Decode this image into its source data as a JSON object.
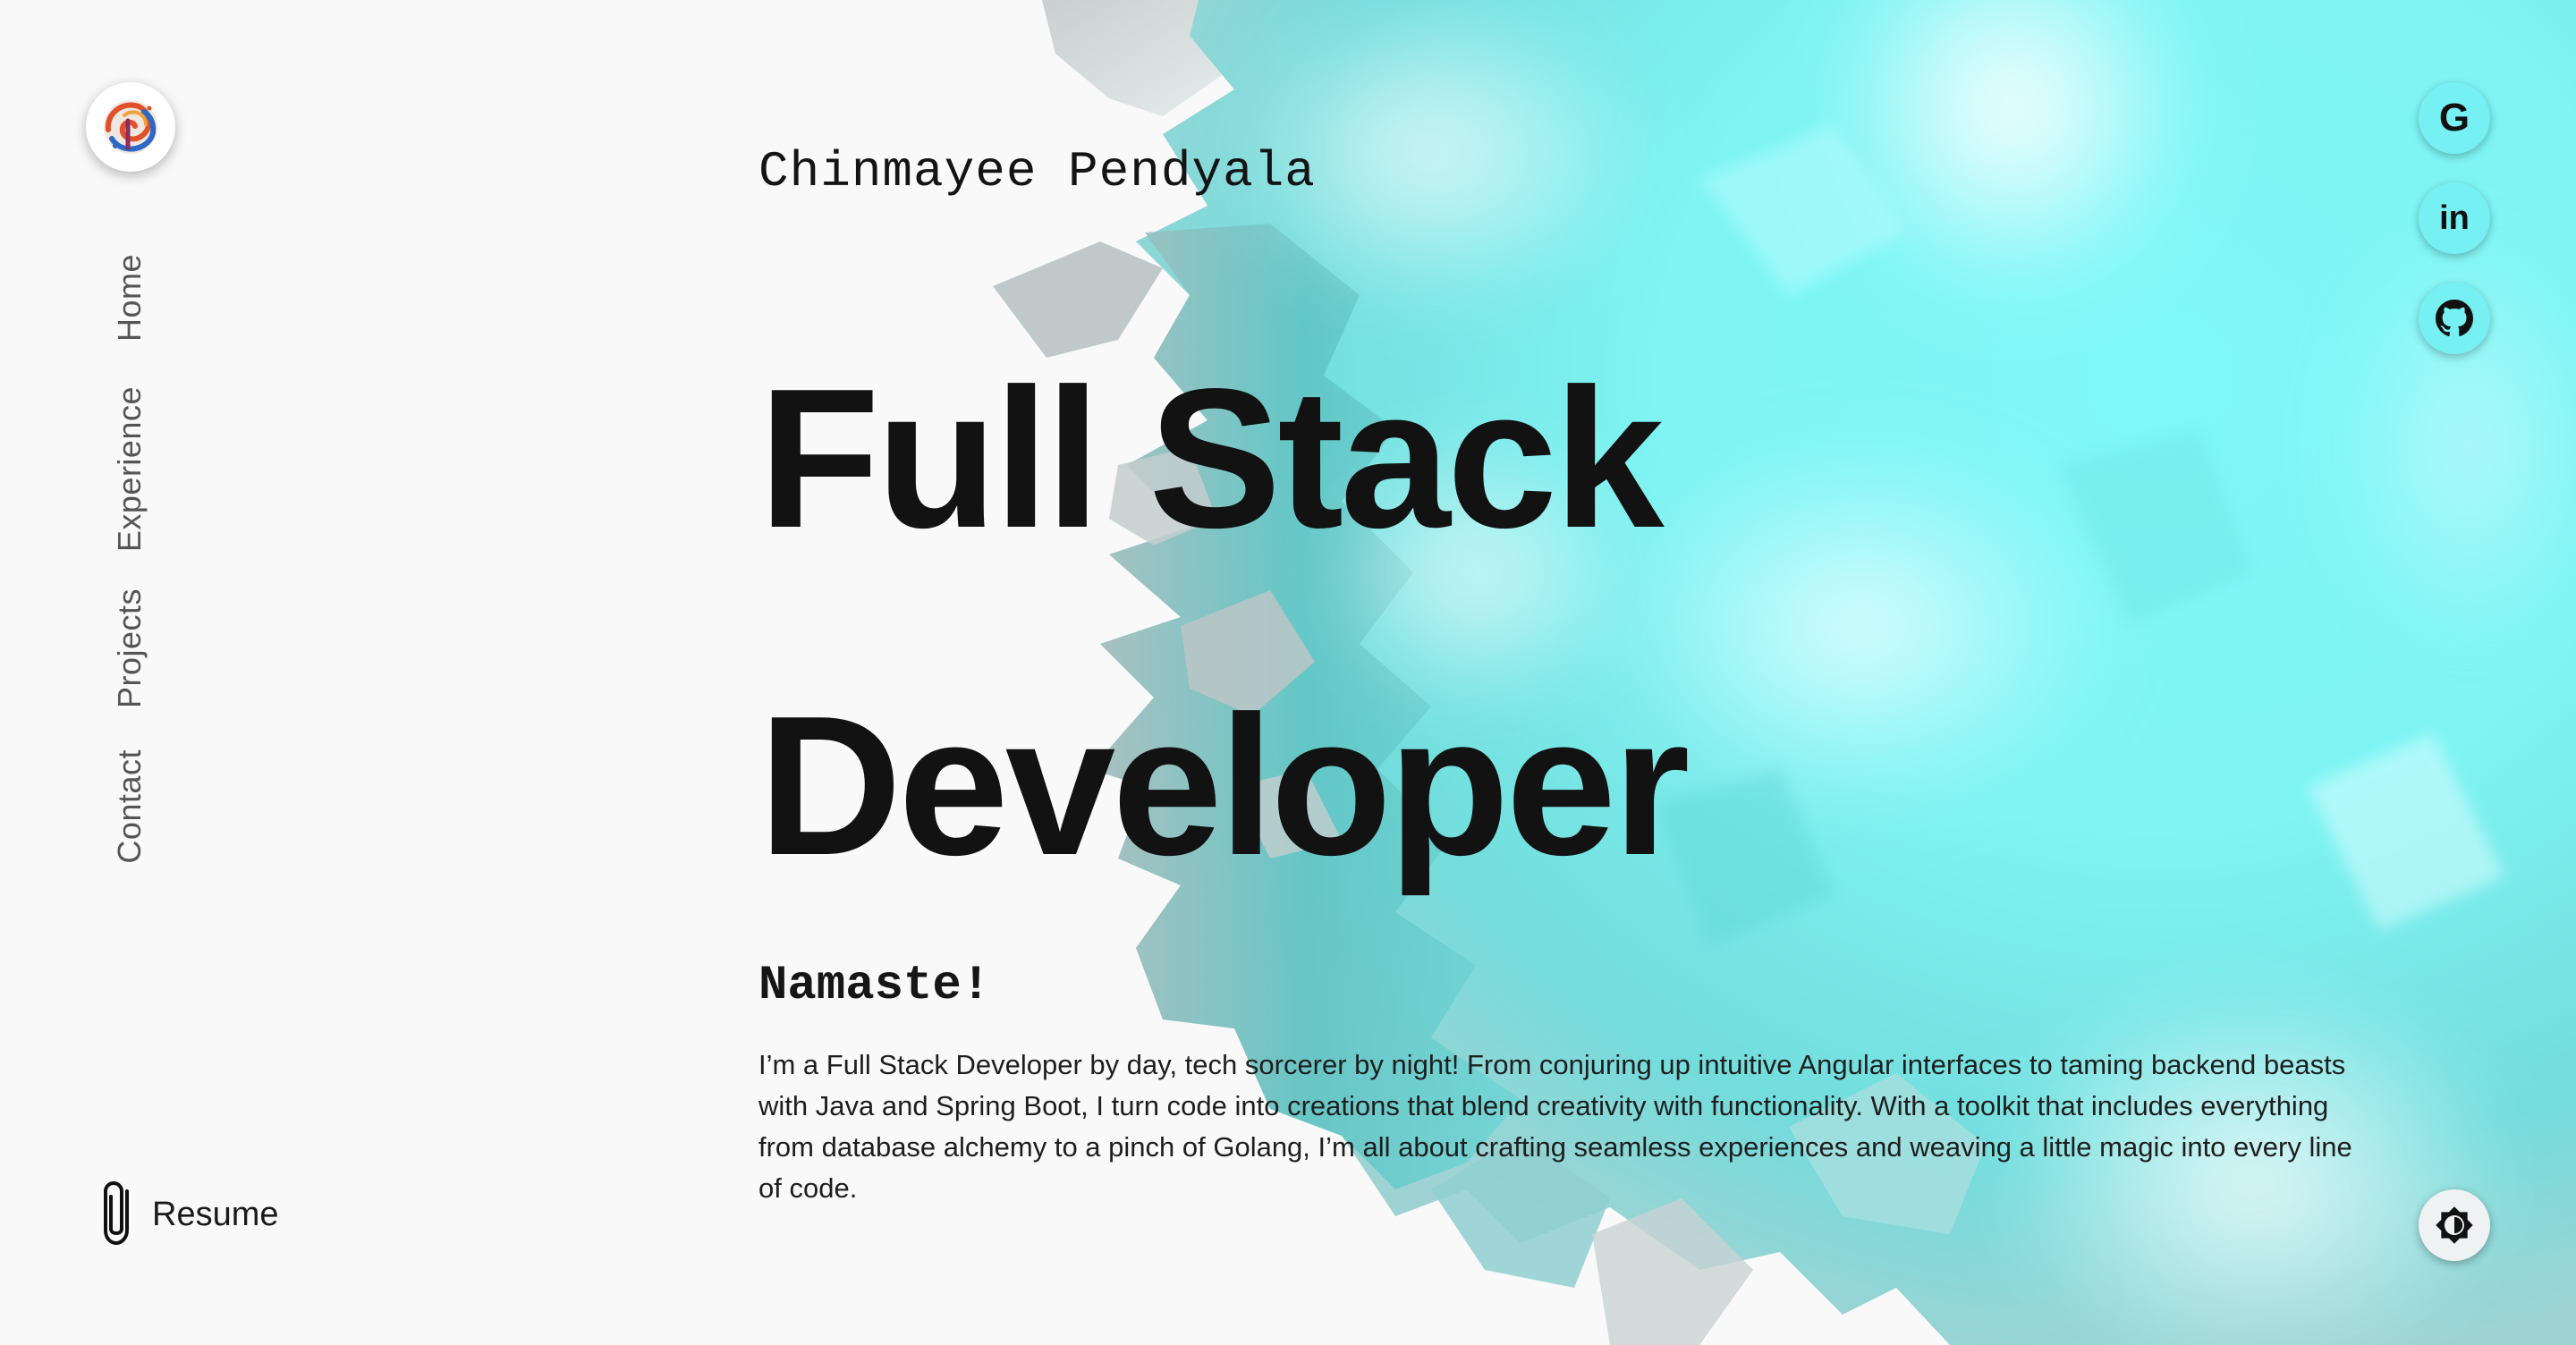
{
  "brand": {
    "logo_icon": "swirl-logo-icon",
    "accent": "#76f0f2",
    "shadow": "#5cc3c6"
  },
  "nav": {
    "items": [
      {
        "label": "Home"
      },
      {
        "label": "Experience"
      },
      {
        "label": "Projects"
      },
      {
        "label": "Contact"
      }
    ]
  },
  "resume": {
    "label": "Resume",
    "icon": "paperclip-icon"
  },
  "hero": {
    "name": "Chinmayee Pendyala",
    "title_line1": "Full Stack",
    "title_line2": "Developer",
    "greeting": "Namaste!",
    "intro": "I’m a Full Stack Developer by day, tech sorcerer by night! From conjuring up intuitive Angular interfaces to taming backend beasts with Java and Spring Boot, I turn code into creations that blend creativity with functionality. With a toolkit that includes everything from database alchemy to a pinch of Golang, I’m all about crafting seamless experiences and weaving a little magic into every line of code."
  },
  "social": {
    "google": {
      "glyph": "G",
      "icon": "google-icon"
    },
    "linkedin": {
      "glyph": "in",
      "icon": "linkedin-icon"
    },
    "github": {
      "icon": "github-icon"
    }
  },
  "theme_toggle": {
    "icon": "brightness-icon"
  }
}
